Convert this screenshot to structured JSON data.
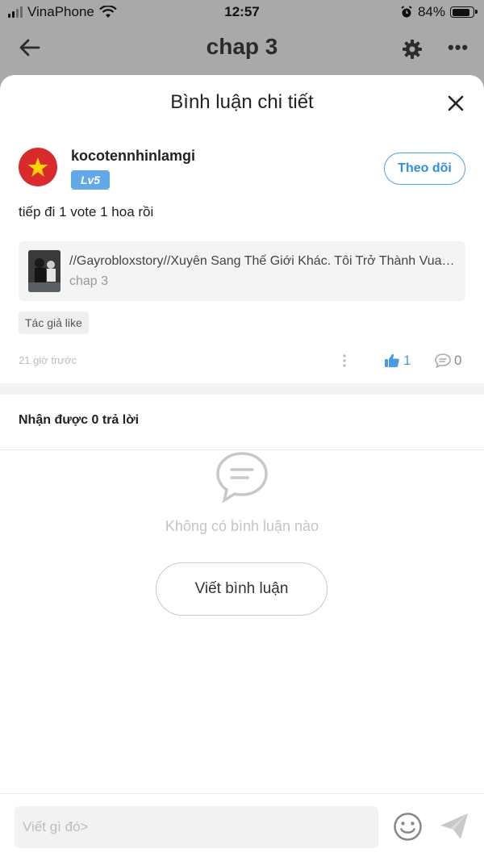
{
  "status_bar": {
    "carrier": "VinaPhone",
    "time": "12:57",
    "battery": "84%",
    "battery_level": 0.84
  },
  "app_header": {
    "title": "chap 3"
  },
  "sheet": {
    "title": "Bình luận chi tiết"
  },
  "comment": {
    "username": "kocotennhinlamgi",
    "level": "Lv5",
    "follow_label": "Theo dõi",
    "text": "tiếp đi 1 vote 1 hoa rồi",
    "story_title": "//Gayrobloxstory//Xuyên Sang Thế Giới Khác. Tôi Trở Thành Vua Của Đám",
    "story_chapter": "chap 3",
    "tag": "Tác giả like",
    "timestamp": "21 giờ trước",
    "likes": "1",
    "replies": "0"
  },
  "replies_section": {
    "title": "Nhận được 0 trả lời",
    "empty_text": "Không có bình luận nào",
    "write_button": "Viết bình luận"
  },
  "composer": {
    "placeholder": "Viết gì đó>"
  },
  "colors": {
    "accent_blue": "#4aa3e8",
    "badge_blue": "#63a8ea",
    "flag_red": "#d92b2b",
    "flag_star": "#ffd400"
  }
}
